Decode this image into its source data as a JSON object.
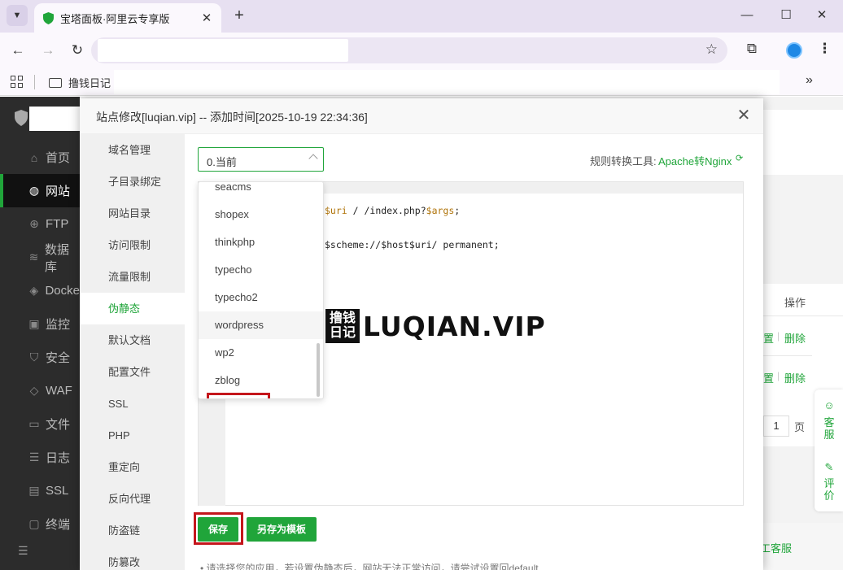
{
  "browser": {
    "tab_title": "宝塔面板·阿里云专享版",
    "bookmark_folder": "撸钱日记"
  },
  "sidebar": {
    "items": [
      {
        "label": "首页",
        "icon": "home-icon"
      },
      {
        "label": "网站",
        "icon": "globe-icon"
      },
      {
        "label": "FTP",
        "icon": "ftp-icon"
      },
      {
        "label": "数据库",
        "icon": "database-icon"
      },
      {
        "label": "Docke",
        "icon": "docker-icon"
      },
      {
        "label": "监控",
        "icon": "monitor-icon"
      },
      {
        "label": "安全",
        "icon": "shield-icon"
      },
      {
        "label": "WAF",
        "icon": "waf-icon"
      },
      {
        "label": "文件",
        "icon": "folder-icon"
      },
      {
        "label": "日志",
        "icon": "log-icon"
      },
      {
        "label": "SSL",
        "icon": "ssl-icon"
      },
      {
        "label": "终端",
        "icon": "terminal-icon"
      }
    ],
    "active": "网站"
  },
  "background": {
    "op_header": "操作",
    "row_links": [
      "置",
      "删除"
    ],
    "page_number": "1",
    "page_unit": "页",
    "float_service": "客服",
    "float_review": "评价",
    "footer_link": "工客服"
  },
  "modal": {
    "title": "站点修改[luqian.vip] -- 添加时间[2025-10-19 22:34:36]",
    "menu": [
      "域名管理",
      "子目录绑定",
      "网站目录",
      "访问限制",
      "流量限制",
      "伪静态",
      "默认文档",
      "配置文件",
      "SSL",
      "PHP",
      "重定向",
      "反向代理",
      "防盗链",
      "防篡改"
    ],
    "active_menu": "伪静态",
    "preset_select_value": "0.当前",
    "tool_label": "规则转换工具:",
    "tool_link": "Apache转Nginx",
    "code_lines": [
      {
        "pre": "",
        "var": "$uri",
        "post": "/ /index.php?",
        "var2": "$args",
        "tail": ";"
      },
      {
        "pre": "",
        "var": "",
        "post": "$scheme://$host$uri/ permanent;",
        "var2": "",
        "tail": ""
      }
    ],
    "dropdown_options": [
      "seacms",
      "shopex",
      "thinkphp",
      "typecho",
      "typecho2",
      "wordpress",
      "wp2",
      "zblog"
    ],
    "dropdown_highlighted": "wordpress",
    "save_button": "保存",
    "save_template_button": "另存为模板",
    "note": "• 请选择您的应用，若设置伪静态后，网站无法正常访问，请尝试设置回default"
  },
  "watermark": {
    "box_text": "撸钱日记",
    "text": "LUQIAN.VIP"
  },
  "colors": {
    "accent": "#20a53a",
    "highlight_border": "#c4161c",
    "sidebar_bg": "#2c2c2c"
  }
}
